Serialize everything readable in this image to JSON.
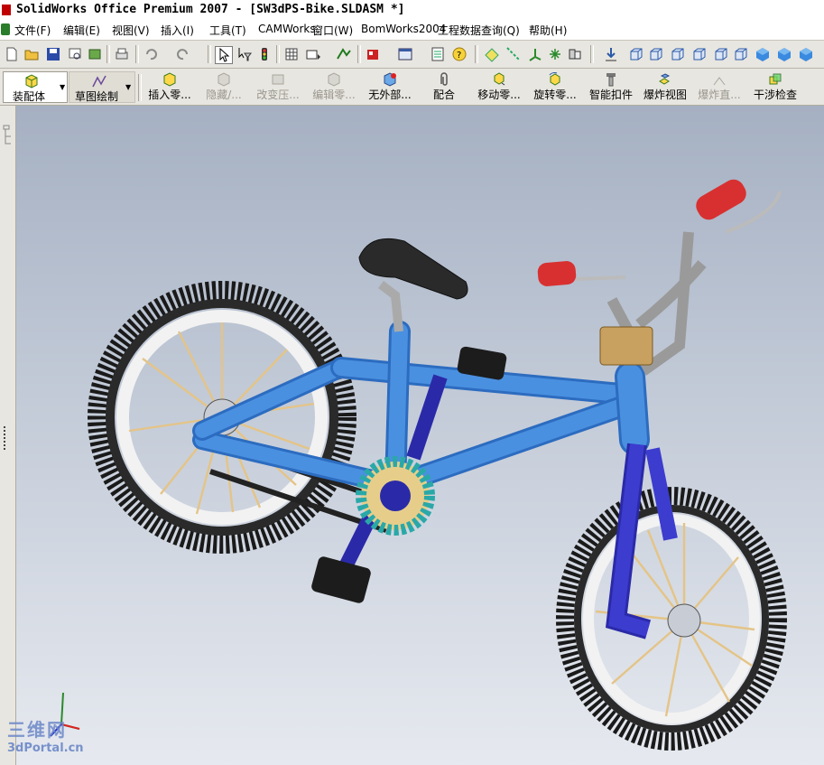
{
  "window": {
    "title": "SolidWorks Office Premium 2007 - [SW3dPS-Bike.SLDASM *]"
  },
  "menubar": {
    "items": [
      {
        "id": "file",
        "label": "文件(F)"
      },
      {
        "id": "edit",
        "label": "编辑(E)"
      },
      {
        "id": "view",
        "label": "视图(V)"
      },
      {
        "id": "insert",
        "label": "插入(I)"
      },
      {
        "id": "tools",
        "label": "工具(T)"
      },
      {
        "id": "camworks",
        "label": "CAMWorks"
      },
      {
        "id": "window",
        "label": "窗口(W)"
      },
      {
        "id": "bomworks",
        "label": "BomWorks2004"
      },
      {
        "id": "pdm",
        "label": "工程数据查询(Q)"
      },
      {
        "id": "help",
        "label": "帮助(H)"
      }
    ]
  },
  "command_manager": {
    "tabs": [
      {
        "id": "assembly",
        "label": "装配体"
      },
      {
        "id": "sketch",
        "label": "草图绘制"
      }
    ],
    "commands": [
      {
        "id": "insert-component",
        "label": "插入零...",
        "enabled": true
      },
      {
        "id": "hide-show",
        "label": "隐藏/...",
        "enabled": false
      },
      {
        "id": "change-suppression",
        "label": "改变压...",
        "enabled": false
      },
      {
        "id": "edit-component",
        "label": "编辑零...",
        "enabled": false
      },
      {
        "id": "no-external",
        "label": "无外部...",
        "enabled": true
      },
      {
        "id": "mate",
        "label": "配合",
        "enabled": true
      },
      {
        "id": "move-component",
        "label": "移动零...",
        "enabled": true
      },
      {
        "id": "rotate-component",
        "label": "旋转零...",
        "enabled": true
      },
      {
        "id": "smart-fasteners",
        "label": "智能扣件",
        "enabled": true
      },
      {
        "id": "exploded-view",
        "label": "爆炸视图",
        "enabled": true
      },
      {
        "id": "explode-line",
        "label": "爆炸直...",
        "enabled": false
      },
      {
        "id": "interference",
        "label": "干涉检查",
        "enabled": true
      }
    ]
  },
  "watermark": {
    "logo": "三维网",
    "url": "3dPortal.cn"
  },
  "colors": {
    "frame": "#4a90e0",
    "fork": "#3c3ccf",
    "grip": "#d83030",
    "sprocket": "#2aa8a8",
    "viewport_top": "#a5b0c2",
    "viewport_bottom": "#e6e9ef"
  }
}
